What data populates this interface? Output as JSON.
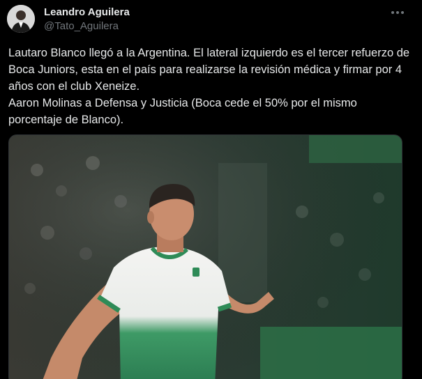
{
  "author": {
    "display_name": "Leandro Aguilera",
    "handle": "@Tato_Aguilera",
    "avatar_icon": "user-avatar"
  },
  "menu": {
    "icon": "more-horizontal-icon"
  },
  "tweet": {
    "text": "Lautaro Blanco llegó a la Argentina. El lateral izquierdo es el tercer refuerzo de Boca Juniors, esta en el país para realizarse la revisión médica y firmar por 4 años con el club Xeneize.\nAaron Molinas a Defensa y Justicia (Boca cede el 50% por el mismo porcentaje de Blanco)."
  },
  "media": {
    "kind": "photo",
    "subject": "football-player-photo",
    "colors": {
      "stadium": "#2b3a32",
      "kit_white": "#f2f2f0",
      "kit_green": "#2e8b57",
      "skin": "#c98d6e",
      "hair": "#2a2420"
    }
  },
  "theme": {
    "background": "#000000",
    "text_primary": "#e7e9ea",
    "text_secondary": "#71767b",
    "border": "#2f3336"
  }
}
